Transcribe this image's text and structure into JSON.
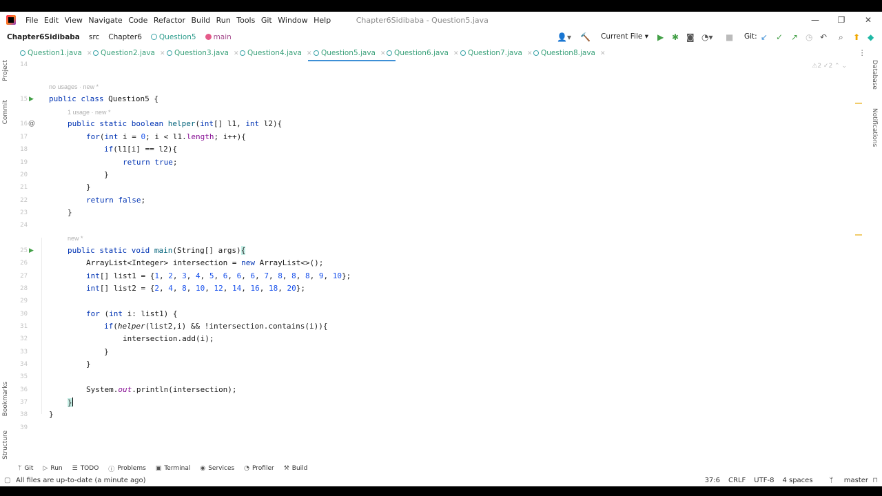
{
  "menu": {
    "items": [
      "File",
      "Edit",
      "View",
      "Navigate",
      "Code",
      "Refactor",
      "Build",
      "Run",
      "Tools",
      "Git",
      "Window",
      "Help"
    ],
    "window_title": "Chapter6Sidibaba - Question5.java"
  },
  "nav": {
    "project": "Chapter6Sidibaba",
    "src": "src",
    "package": "Chapter6",
    "class": "Question5",
    "method": "main",
    "run_config": "Current File",
    "git_label": "Git:"
  },
  "left_tools": [
    "Project",
    "Commit",
    "Bookmarks",
    "Structure"
  ],
  "right_tools": [
    "Database",
    "Notifications"
  ],
  "tabs": [
    {
      "label": "Question1.java",
      "active": false
    },
    {
      "label": "Question2.java",
      "active": false
    },
    {
      "label": "Question3.java",
      "active": false
    },
    {
      "label": "Question4.java",
      "active": false
    },
    {
      "label": "Question5.java",
      "active": true
    },
    {
      "label": "Question6.java",
      "active": false
    },
    {
      "label": "Question7.java",
      "active": false
    },
    {
      "label": "Question8.java",
      "active": false
    }
  ],
  "editor": {
    "inspection_counts": "⚠2 ✓2",
    "hints": {
      "class_usages": "no usages · new *",
      "helper_usages": "1 usage · new *",
      "main_hint": "new *"
    },
    "line_numbers": [
      "14",
      "15",
      "16",
      "17",
      "18",
      "19",
      "20",
      "21",
      "22",
      "23",
      "24",
      "25",
      "26",
      "27",
      "28",
      "29",
      "30",
      "31",
      "32",
      "33",
      "34",
      "35",
      "36",
      "37",
      "38",
      "39"
    ],
    "code": {
      "l15": [
        "public class ",
        "Question5 {"
      ],
      "l16": [
        "public static boolean ",
        "helper",
        "(",
        "int",
        "[] l1, ",
        "int",
        " l2){"
      ],
      "l17": [
        "for",
        "(",
        "int",
        " i = ",
        "0",
        "; i < l1.",
        "length",
        "; i++){"
      ],
      "l18": [
        "if",
        "(l1[i] == l2){"
      ],
      "l19": [
        "return true",
        ";"
      ],
      "l20": "}",
      "l21": "}",
      "l22": [
        "return false",
        ";"
      ],
      "l23": "}",
      "l25": [
        "public static void ",
        "main",
        "(String[] args)",
        "{"
      ],
      "l26": [
        "ArrayList<Integer> intersection = ",
        "new",
        " ArrayList<>();"
      ],
      "l27_prefix": "int[] list1 = {",
      "l27_values": [
        "1",
        "2",
        "3",
        "4",
        "5",
        "6",
        "6",
        "6",
        "7",
        "8",
        "8",
        "8",
        "9",
        "10"
      ],
      "l28_prefix": "int[] list2 = {",
      "l28_values": [
        "2",
        "4",
        "8",
        "10",
        "12",
        "14",
        "16",
        "18",
        "20"
      ],
      "list_suffix": "};",
      "l30": [
        "for",
        " (",
        "int",
        " i: list1) {"
      ],
      "l31": [
        "if",
        "(",
        "helper",
        "(list2,i) && !intersection.contains(i)){"
      ],
      "l32": "intersection.add(i);",
      "l33": "}",
      "l34": "}",
      "l36": [
        "System.",
        "out",
        ".println(intersection);"
      ],
      "l37": "}",
      "l38": "}"
    }
  },
  "tool_windows": [
    "Git",
    "Run",
    "TODO",
    "Problems",
    "Terminal",
    "Services",
    "Profiler",
    "Build"
  ],
  "status": {
    "message": "All files are up-to-date (a minute ago)",
    "position": "37:6",
    "line_sep": "CRLF",
    "encoding": "UTF-8",
    "indent": "4 spaces",
    "branch": "master"
  }
}
